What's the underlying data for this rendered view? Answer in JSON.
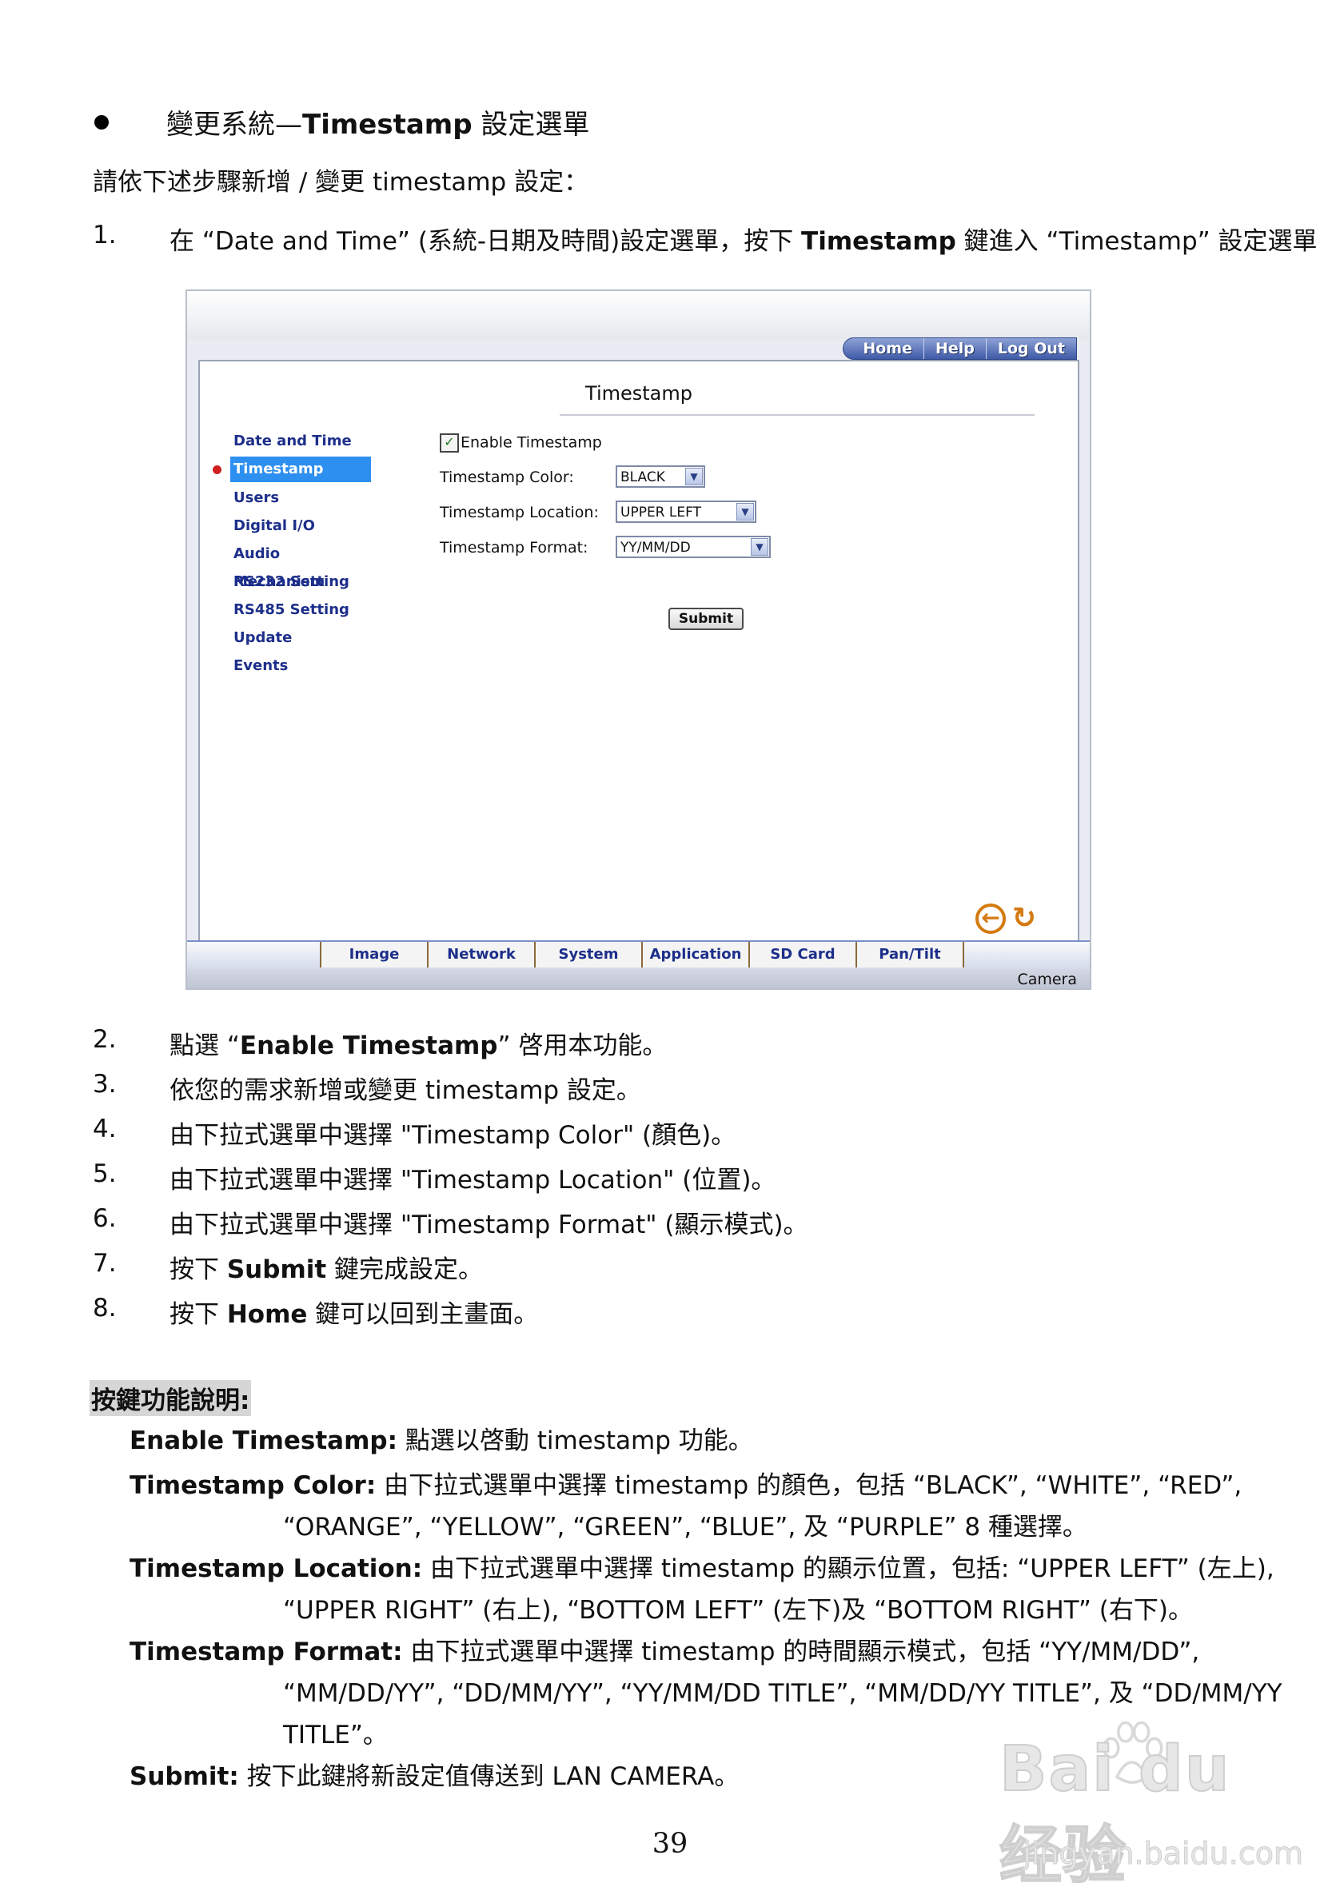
{
  "heading": {
    "prefix": "變更系統—",
    "bold": "Timestamp",
    "suffix": " 設定選單"
  },
  "intro": "請依下述步驟新增 / 變更 timestamp 設定：",
  "step1": {
    "num": "1.",
    "a": "在 “Date and Time” (系統-日期及時間)設定選單，按下 ",
    "b": "Timestamp",
    "c": " 鍵進入 “Timestamp” 設定選單"
  },
  "screenshot": {
    "nav": [
      "Home",
      "Help",
      "Log Out"
    ],
    "title": "Timestamp",
    "menu": [
      "Date and Time",
      "Timestamp",
      "Users",
      "Digital I/O",
      "Audio Mechanism",
      "RS232 Setting",
      "RS485 Setting",
      "Update",
      "Events"
    ],
    "enable_label": "Enable Timestamp",
    "enable_checked": "✓",
    "color_label": "Timestamp Color:",
    "color_value": "BLACK",
    "location_label": "Timestamp Location:",
    "location_value": "UPPER LEFT",
    "format_label": "Timestamp Format:",
    "format_value": "YY/MM/DD",
    "submit": "Submit",
    "tabs": [
      "Image",
      "Network",
      "System",
      "Application",
      "SD Card",
      "Pan/Tilt"
    ],
    "camera": "Camera"
  },
  "steps": [
    {
      "num": "2.",
      "a": "點選 “",
      "b": "Enable Timestamp",
      "c": "” 啓用本功能。"
    },
    {
      "num": "3.",
      "a": "依您的需求新增或變更 timestamp 設定。",
      "b": "",
      "c": ""
    },
    {
      "num": "4.",
      "a": "由下拉式選單中選擇 \"Timestamp Color\" (顏色)。",
      "b": "",
      "c": ""
    },
    {
      "num": "5.",
      "a": "由下拉式選單中選擇 \"Timestamp Location\" (位置)。",
      "b": "",
      "c": ""
    },
    {
      "num": "6.",
      "a": "由下拉式選單中選擇 \"Timestamp Format\" (顯示模式)。",
      "b": "",
      "c": ""
    },
    {
      "num": "7.",
      "a": "按下 ",
      "b": "Submit",
      "c": " 鍵完成設定。"
    },
    {
      "num": "8.",
      "a": "按下 ",
      "b": "Home",
      "c": " 鍵可以回到主畫面。"
    }
  ],
  "section_title": "按鍵功能說明:",
  "defs": {
    "enable": {
      "term": "Enable Timestamp:",
      "text": " 點選以啓動 timestamp 功能。"
    },
    "color": {
      "term": "Timestamp Color:",
      "text": " 由下拉式選單中選擇 timestamp 的顏色，包括 “BLACK”, “WHITE”, “RED”,",
      "cont": "“ORANGE”, “YELLOW”, “GREEN”, “BLUE”, 及 “PURPLE” 8 種選擇。"
    },
    "location": {
      "term": "Timestamp Location:",
      "text": " 由下拉式選單中選擇 timestamp 的顯示位置，包括: “UPPER LEFT” (左上),",
      "cont": "“UPPER RIGHT” (右上), “BOTTOM LEFT” (左下)及 “BOTTOM RIGHT” (右下)。"
    },
    "format": {
      "term": "Timestamp Format:",
      "text": " 由下拉式選單中選擇 timestamp 的時間顯示模式，包括 “YY/MM/DD”,",
      "cont": "“MM/DD/YY”, “DD/MM/YY”, “YY/MM/DD TITLE”, “MM/DD/YY TITLE”, 及 “DD/MM/YY",
      "cont2": "TITLE”。"
    },
    "submit": {
      "term": "Submit:",
      "text": " 按下此鍵將新設定值傳送到 LAN CAMERA。"
    }
  },
  "page_number": "39",
  "watermark": {
    "brand": "Bai du 经验",
    "url": "jingyan.baidu.com"
  }
}
